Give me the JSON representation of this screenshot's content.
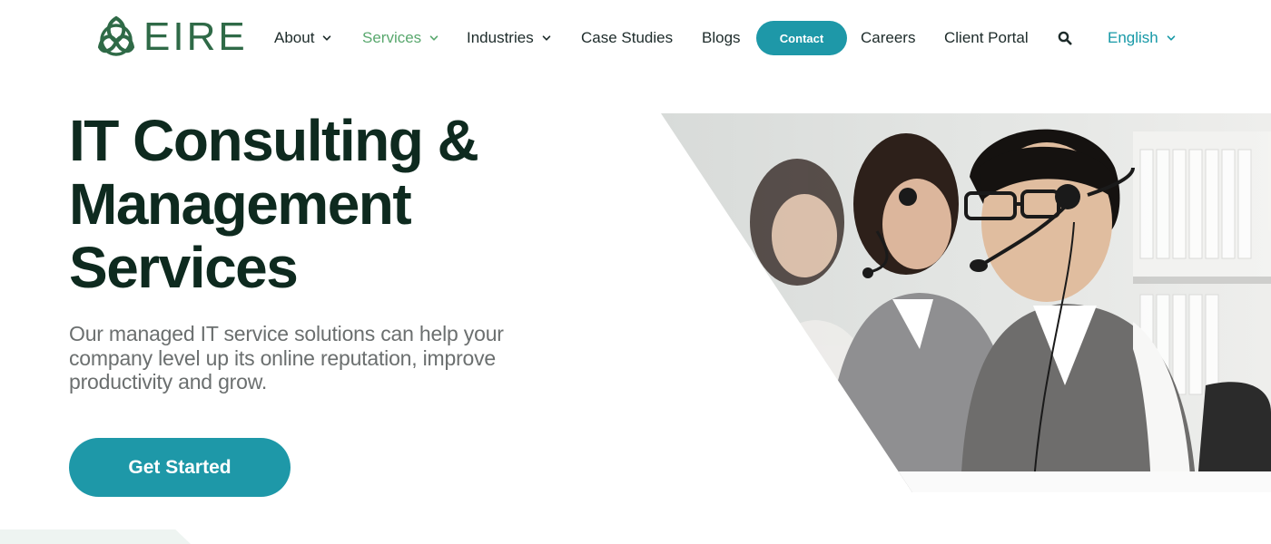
{
  "brand": {
    "name": "EIRE",
    "logo_icon": "celtic-knot-icon",
    "color": "#2f6a47"
  },
  "nav": {
    "items": [
      {
        "label": "About",
        "has_dropdown": true
      },
      {
        "label": "Services",
        "has_dropdown": true,
        "active": true
      },
      {
        "label": "Industries",
        "has_dropdown": true
      },
      {
        "label": "Case Studies",
        "has_dropdown": false
      },
      {
        "label": "Blogs",
        "has_dropdown": false
      }
    ],
    "contact_label": "Contact",
    "after_items": [
      {
        "label": "Careers"
      },
      {
        "label": "Client Portal"
      }
    ],
    "search_icon": "search-icon",
    "language": "English"
  },
  "hero": {
    "title_lines": [
      "IT Consulting &",
      "Management",
      "Services"
    ],
    "subtitle_lines": [
      "Our managed IT service solutions can help your",
      "company level up its online reputation, improve",
      "productivity and grow."
    ],
    "cta_label": "Get Started",
    "image_alt": "Customer support agents wearing headsets in an office"
  },
  "colors": {
    "accent": "#1e98a8",
    "active_nav": "#59a86e",
    "heading": "#0e2a1f",
    "body_text": "#6b6f6f"
  }
}
